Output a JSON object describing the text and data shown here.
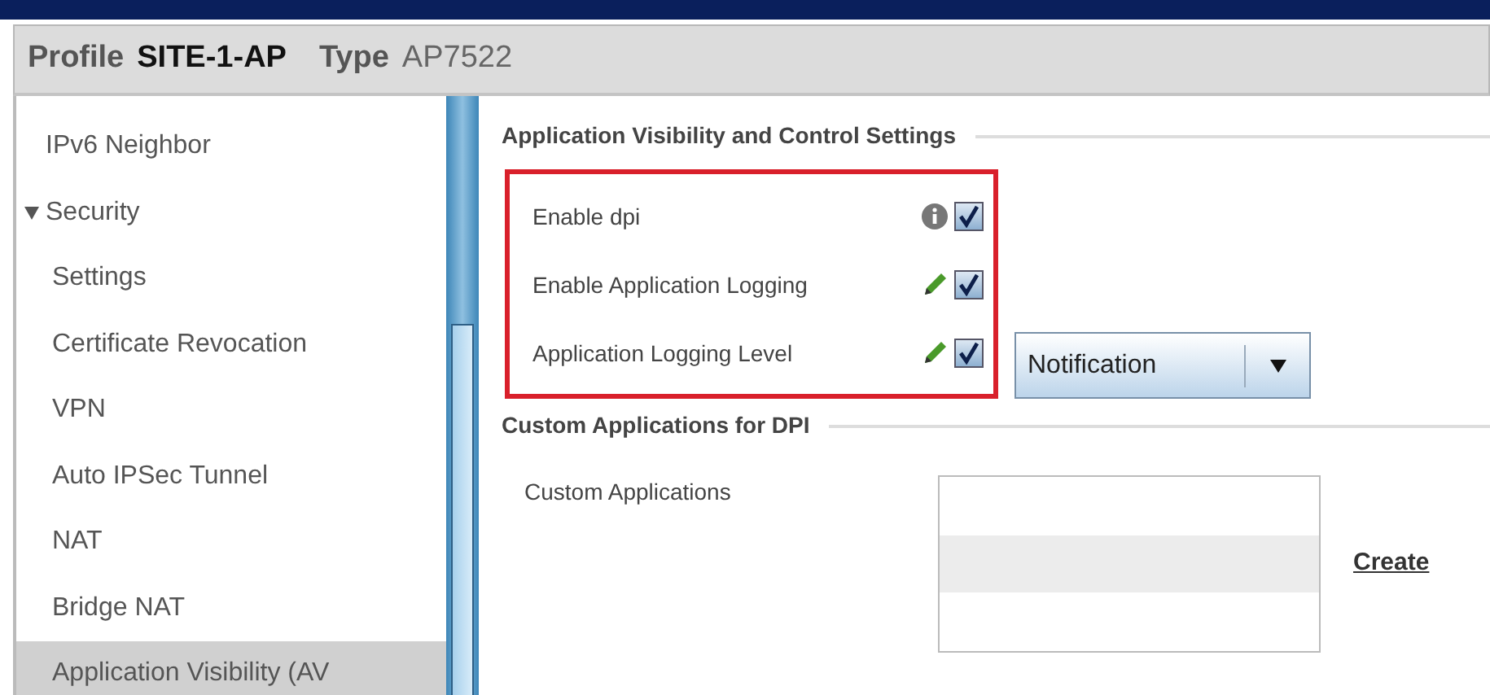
{
  "header": {
    "profile_label": "Profile",
    "profile_value": "SITE-1-AP",
    "type_label": "Type",
    "type_value": "AP7522"
  },
  "sidebar": {
    "items": [
      {
        "label": "IPv6 Neighbor",
        "selected": false
      },
      {
        "label": "Security",
        "expanded": true,
        "selected": false,
        "children": [
          {
            "label": "Settings",
            "selected": false
          },
          {
            "label": "Certificate Revocation",
            "selected": false
          },
          {
            "label": "VPN",
            "selected": false
          },
          {
            "label": "Auto IPSec Tunnel",
            "selected": false
          },
          {
            "label": "NAT",
            "selected": false
          },
          {
            "label": "Bridge NAT",
            "selected": false
          },
          {
            "label": "Application Visibility (AV",
            "selected": true
          }
        ]
      }
    ]
  },
  "sections": [
    {
      "title": "Application Visibility and Control Settings",
      "highlighted": true,
      "fields": [
        {
          "label": "Enable dpi",
          "kind": "info",
          "checked": true
        },
        {
          "label": "Enable Application Logging",
          "kind": "editable",
          "checked": true
        },
        {
          "label": "Application Logging Level",
          "kind": "editable",
          "checked": true,
          "dropdown": "Notification"
        }
      ]
    },
    {
      "title": "Custom Applications for DPI",
      "list_label": "Custom Applications",
      "link": "Create"
    }
  ]
}
